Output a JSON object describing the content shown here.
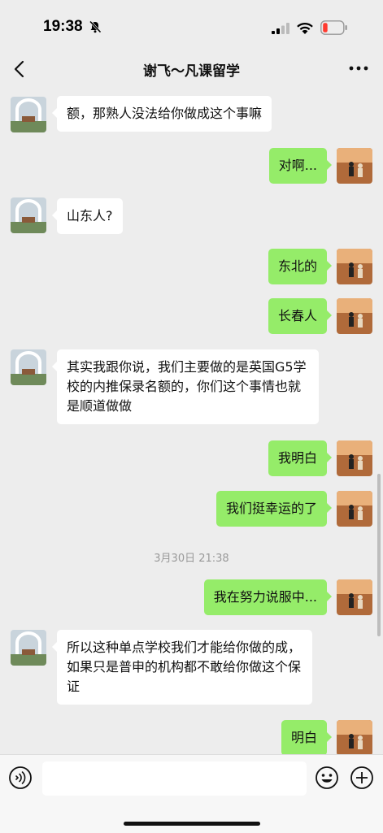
{
  "status_bar": {
    "time": "19:38"
  },
  "header": {
    "title": "谢飞～凡课留学"
  },
  "messages": [
    {
      "side": "in",
      "text": "额，那熟人没法给你做成这个事嘛"
    },
    {
      "side": "out",
      "text": "对啊..."
    },
    {
      "side": "in",
      "text": "山东人?"
    },
    {
      "side": "out",
      "text": "东北的"
    },
    {
      "side": "out",
      "text": "长春人"
    },
    {
      "side": "in",
      "text": "其实我跟你说，我们主要做的是英国G5学校的内推保录名额的，你们这个事情也就是顺道做做"
    },
    {
      "side": "out",
      "text": "我明白"
    },
    {
      "side": "out",
      "text": "我们挺幸运的了"
    },
    {
      "side": "out",
      "text": "我在努力说服中..."
    },
    {
      "side": "in",
      "text": "所以这种单点学校我们才能给你做的成，如果只是普申的机构都不敢给你做这个保证"
    },
    {
      "side": "out",
      "text": "明白"
    }
  ],
  "timestamp": "3月30日 21:38",
  "icons": {
    "back": "chevron-left-icon",
    "more": "more-dots-icon",
    "voice": "voice-icon",
    "emoji": "emoji-icon",
    "plus": "plus-icon"
  },
  "colors": {
    "outgoing_bubble": "#95ec69",
    "incoming_bubble": "#ffffff",
    "background": "#ededed"
  }
}
